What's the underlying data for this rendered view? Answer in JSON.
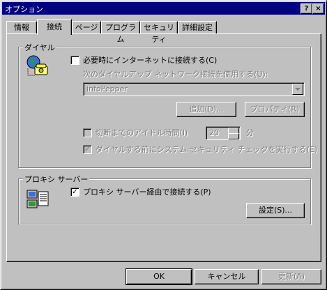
{
  "window": {
    "title": "オプション",
    "help_label": "?",
    "close_label": "×"
  },
  "tabs": [
    {
      "label": "情報"
    },
    {
      "label": "接続"
    },
    {
      "label": "ページ"
    },
    {
      "label": "プログラム"
    },
    {
      "label": "セキュリティ"
    },
    {
      "label": "詳細設定"
    }
  ],
  "dial": {
    "group_title": "ダイヤル",
    "connect_when_needed": "必要時にインターネットに接続する(C)",
    "use_dialup_label": "次のダイヤルアップ ネットワーク接続を使用する(U):",
    "connection_name": "infoPepper",
    "add_button": "追加(D)...",
    "properties_button": "プロパティ(R)",
    "idle_label": "切断までのアイドル時間(I)",
    "idle_value": "20",
    "idle_unit": "分",
    "security_check_label": "ダイヤルする前にシステム セキュリティ チェックを実行する(E)",
    "connect_checked": false,
    "idle_checked": false,
    "security_checked": true
  },
  "proxy": {
    "group_title": "プロキシ サーバー",
    "via_proxy_label": "プロキシ サーバー経由で接続する(P)",
    "via_proxy_checked": true,
    "settings_button": "設定(S)..."
  },
  "footer": {
    "ok": "OK",
    "cancel": "キャンセル",
    "apply": "更新(A)"
  }
}
